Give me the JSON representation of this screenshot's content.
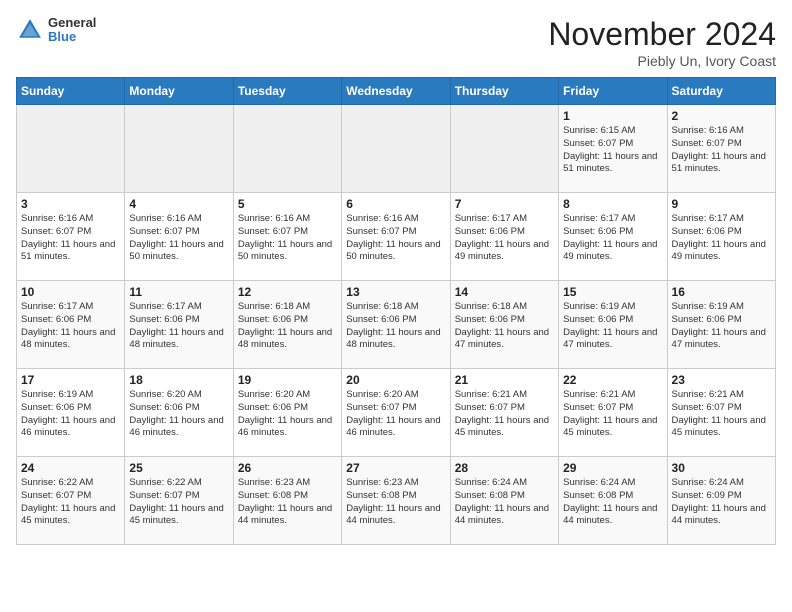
{
  "header": {
    "logo_general": "General",
    "logo_blue": "Blue",
    "month_title": "November 2024",
    "subtitle": "Piebly Un, Ivory Coast"
  },
  "weekdays": [
    "Sunday",
    "Monday",
    "Tuesday",
    "Wednesday",
    "Thursday",
    "Friday",
    "Saturday"
  ],
  "weeks": [
    [
      {
        "day": "",
        "info": ""
      },
      {
        "day": "",
        "info": ""
      },
      {
        "day": "",
        "info": ""
      },
      {
        "day": "",
        "info": ""
      },
      {
        "day": "",
        "info": ""
      },
      {
        "day": "1",
        "info": "Sunrise: 6:15 AM\nSunset: 6:07 PM\nDaylight: 11 hours\nand 51 minutes."
      },
      {
        "day": "2",
        "info": "Sunrise: 6:16 AM\nSunset: 6:07 PM\nDaylight: 11 hours\nand 51 minutes."
      }
    ],
    [
      {
        "day": "3",
        "info": "Sunrise: 6:16 AM\nSunset: 6:07 PM\nDaylight: 11 hours\nand 51 minutes."
      },
      {
        "day": "4",
        "info": "Sunrise: 6:16 AM\nSunset: 6:07 PM\nDaylight: 11 hours\nand 50 minutes."
      },
      {
        "day": "5",
        "info": "Sunrise: 6:16 AM\nSunset: 6:07 PM\nDaylight: 11 hours\nand 50 minutes."
      },
      {
        "day": "6",
        "info": "Sunrise: 6:16 AM\nSunset: 6:07 PM\nDaylight: 11 hours\nand 50 minutes."
      },
      {
        "day": "7",
        "info": "Sunrise: 6:17 AM\nSunset: 6:06 PM\nDaylight: 11 hours\nand 49 minutes."
      },
      {
        "day": "8",
        "info": "Sunrise: 6:17 AM\nSunset: 6:06 PM\nDaylight: 11 hours\nand 49 minutes."
      },
      {
        "day": "9",
        "info": "Sunrise: 6:17 AM\nSunset: 6:06 PM\nDaylight: 11 hours\nand 49 minutes."
      }
    ],
    [
      {
        "day": "10",
        "info": "Sunrise: 6:17 AM\nSunset: 6:06 PM\nDaylight: 11 hours\nand 48 minutes."
      },
      {
        "day": "11",
        "info": "Sunrise: 6:17 AM\nSunset: 6:06 PM\nDaylight: 11 hours\nand 48 minutes."
      },
      {
        "day": "12",
        "info": "Sunrise: 6:18 AM\nSunset: 6:06 PM\nDaylight: 11 hours\nand 48 minutes."
      },
      {
        "day": "13",
        "info": "Sunrise: 6:18 AM\nSunset: 6:06 PM\nDaylight: 11 hours\nand 48 minutes."
      },
      {
        "day": "14",
        "info": "Sunrise: 6:18 AM\nSunset: 6:06 PM\nDaylight: 11 hours\nand 47 minutes."
      },
      {
        "day": "15",
        "info": "Sunrise: 6:19 AM\nSunset: 6:06 PM\nDaylight: 11 hours\nand 47 minutes."
      },
      {
        "day": "16",
        "info": "Sunrise: 6:19 AM\nSunset: 6:06 PM\nDaylight: 11 hours\nand 47 minutes."
      }
    ],
    [
      {
        "day": "17",
        "info": "Sunrise: 6:19 AM\nSunset: 6:06 PM\nDaylight: 11 hours\nand 46 minutes."
      },
      {
        "day": "18",
        "info": "Sunrise: 6:20 AM\nSunset: 6:06 PM\nDaylight: 11 hours\nand 46 minutes."
      },
      {
        "day": "19",
        "info": "Sunrise: 6:20 AM\nSunset: 6:06 PM\nDaylight: 11 hours\nand 46 minutes."
      },
      {
        "day": "20",
        "info": "Sunrise: 6:20 AM\nSunset: 6:07 PM\nDaylight: 11 hours\nand 46 minutes."
      },
      {
        "day": "21",
        "info": "Sunrise: 6:21 AM\nSunset: 6:07 PM\nDaylight: 11 hours\nand 45 minutes."
      },
      {
        "day": "22",
        "info": "Sunrise: 6:21 AM\nSunset: 6:07 PM\nDaylight: 11 hours\nand 45 minutes."
      },
      {
        "day": "23",
        "info": "Sunrise: 6:21 AM\nSunset: 6:07 PM\nDaylight: 11 hours\nand 45 minutes."
      }
    ],
    [
      {
        "day": "24",
        "info": "Sunrise: 6:22 AM\nSunset: 6:07 PM\nDaylight: 11 hours\nand 45 minutes."
      },
      {
        "day": "25",
        "info": "Sunrise: 6:22 AM\nSunset: 6:07 PM\nDaylight: 11 hours\nand 45 minutes."
      },
      {
        "day": "26",
        "info": "Sunrise: 6:23 AM\nSunset: 6:08 PM\nDaylight: 11 hours\nand 44 minutes."
      },
      {
        "day": "27",
        "info": "Sunrise: 6:23 AM\nSunset: 6:08 PM\nDaylight: 11 hours\nand 44 minutes."
      },
      {
        "day": "28",
        "info": "Sunrise: 6:24 AM\nSunset: 6:08 PM\nDaylight: 11 hours\nand 44 minutes."
      },
      {
        "day": "29",
        "info": "Sunrise: 6:24 AM\nSunset: 6:08 PM\nDaylight: 11 hours\nand 44 minutes."
      },
      {
        "day": "30",
        "info": "Sunrise: 6:24 AM\nSunset: 6:09 PM\nDaylight: 11 hours\nand 44 minutes."
      }
    ]
  ]
}
